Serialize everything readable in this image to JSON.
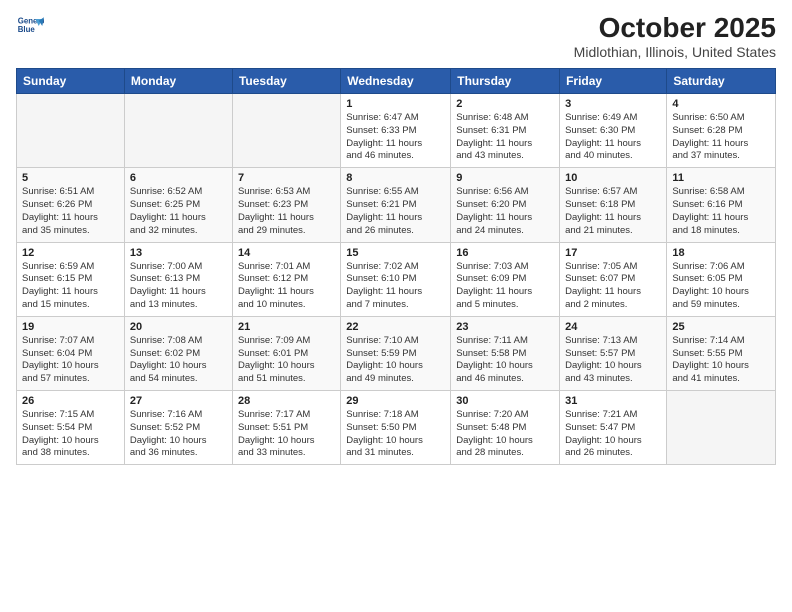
{
  "header": {
    "logo_line1": "General",
    "logo_line2": "Blue",
    "title": "October 2025",
    "subtitle": "Midlothian, Illinois, United States"
  },
  "weekdays": [
    "Sunday",
    "Monday",
    "Tuesday",
    "Wednesday",
    "Thursday",
    "Friday",
    "Saturday"
  ],
  "weeks": [
    [
      {
        "day": "",
        "info": ""
      },
      {
        "day": "",
        "info": ""
      },
      {
        "day": "",
        "info": ""
      },
      {
        "day": "1",
        "info": "Sunrise: 6:47 AM\nSunset: 6:33 PM\nDaylight: 11 hours\nand 46 minutes."
      },
      {
        "day": "2",
        "info": "Sunrise: 6:48 AM\nSunset: 6:31 PM\nDaylight: 11 hours\nand 43 minutes."
      },
      {
        "day": "3",
        "info": "Sunrise: 6:49 AM\nSunset: 6:30 PM\nDaylight: 11 hours\nand 40 minutes."
      },
      {
        "day": "4",
        "info": "Sunrise: 6:50 AM\nSunset: 6:28 PM\nDaylight: 11 hours\nand 37 minutes."
      }
    ],
    [
      {
        "day": "5",
        "info": "Sunrise: 6:51 AM\nSunset: 6:26 PM\nDaylight: 11 hours\nand 35 minutes."
      },
      {
        "day": "6",
        "info": "Sunrise: 6:52 AM\nSunset: 6:25 PM\nDaylight: 11 hours\nand 32 minutes."
      },
      {
        "day": "7",
        "info": "Sunrise: 6:53 AM\nSunset: 6:23 PM\nDaylight: 11 hours\nand 29 minutes."
      },
      {
        "day": "8",
        "info": "Sunrise: 6:55 AM\nSunset: 6:21 PM\nDaylight: 11 hours\nand 26 minutes."
      },
      {
        "day": "9",
        "info": "Sunrise: 6:56 AM\nSunset: 6:20 PM\nDaylight: 11 hours\nand 24 minutes."
      },
      {
        "day": "10",
        "info": "Sunrise: 6:57 AM\nSunset: 6:18 PM\nDaylight: 11 hours\nand 21 minutes."
      },
      {
        "day": "11",
        "info": "Sunrise: 6:58 AM\nSunset: 6:16 PM\nDaylight: 11 hours\nand 18 minutes."
      }
    ],
    [
      {
        "day": "12",
        "info": "Sunrise: 6:59 AM\nSunset: 6:15 PM\nDaylight: 11 hours\nand 15 minutes."
      },
      {
        "day": "13",
        "info": "Sunrise: 7:00 AM\nSunset: 6:13 PM\nDaylight: 11 hours\nand 13 minutes."
      },
      {
        "day": "14",
        "info": "Sunrise: 7:01 AM\nSunset: 6:12 PM\nDaylight: 11 hours\nand 10 minutes."
      },
      {
        "day": "15",
        "info": "Sunrise: 7:02 AM\nSunset: 6:10 PM\nDaylight: 11 hours\nand 7 minutes."
      },
      {
        "day": "16",
        "info": "Sunrise: 7:03 AM\nSunset: 6:09 PM\nDaylight: 11 hours\nand 5 minutes."
      },
      {
        "day": "17",
        "info": "Sunrise: 7:05 AM\nSunset: 6:07 PM\nDaylight: 11 hours\nand 2 minutes."
      },
      {
        "day": "18",
        "info": "Sunrise: 7:06 AM\nSunset: 6:05 PM\nDaylight: 10 hours\nand 59 minutes."
      }
    ],
    [
      {
        "day": "19",
        "info": "Sunrise: 7:07 AM\nSunset: 6:04 PM\nDaylight: 10 hours\nand 57 minutes."
      },
      {
        "day": "20",
        "info": "Sunrise: 7:08 AM\nSunset: 6:02 PM\nDaylight: 10 hours\nand 54 minutes."
      },
      {
        "day": "21",
        "info": "Sunrise: 7:09 AM\nSunset: 6:01 PM\nDaylight: 10 hours\nand 51 minutes."
      },
      {
        "day": "22",
        "info": "Sunrise: 7:10 AM\nSunset: 5:59 PM\nDaylight: 10 hours\nand 49 minutes."
      },
      {
        "day": "23",
        "info": "Sunrise: 7:11 AM\nSunset: 5:58 PM\nDaylight: 10 hours\nand 46 minutes."
      },
      {
        "day": "24",
        "info": "Sunrise: 7:13 AM\nSunset: 5:57 PM\nDaylight: 10 hours\nand 43 minutes."
      },
      {
        "day": "25",
        "info": "Sunrise: 7:14 AM\nSunset: 5:55 PM\nDaylight: 10 hours\nand 41 minutes."
      }
    ],
    [
      {
        "day": "26",
        "info": "Sunrise: 7:15 AM\nSunset: 5:54 PM\nDaylight: 10 hours\nand 38 minutes."
      },
      {
        "day": "27",
        "info": "Sunrise: 7:16 AM\nSunset: 5:52 PM\nDaylight: 10 hours\nand 36 minutes."
      },
      {
        "day": "28",
        "info": "Sunrise: 7:17 AM\nSunset: 5:51 PM\nDaylight: 10 hours\nand 33 minutes."
      },
      {
        "day": "29",
        "info": "Sunrise: 7:18 AM\nSunset: 5:50 PM\nDaylight: 10 hours\nand 31 minutes."
      },
      {
        "day": "30",
        "info": "Sunrise: 7:20 AM\nSunset: 5:48 PM\nDaylight: 10 hours\nand 28 minutes."
      },
      {
        "day": "31",
        "info": "Sunrise: 7:21 AM\nSunset: 5:47 PM\nDaylight: 10 hours\nand 26 minutes."
      },
      {
        "day": "",
        "info": ""
      }
    ]
  ]
}
